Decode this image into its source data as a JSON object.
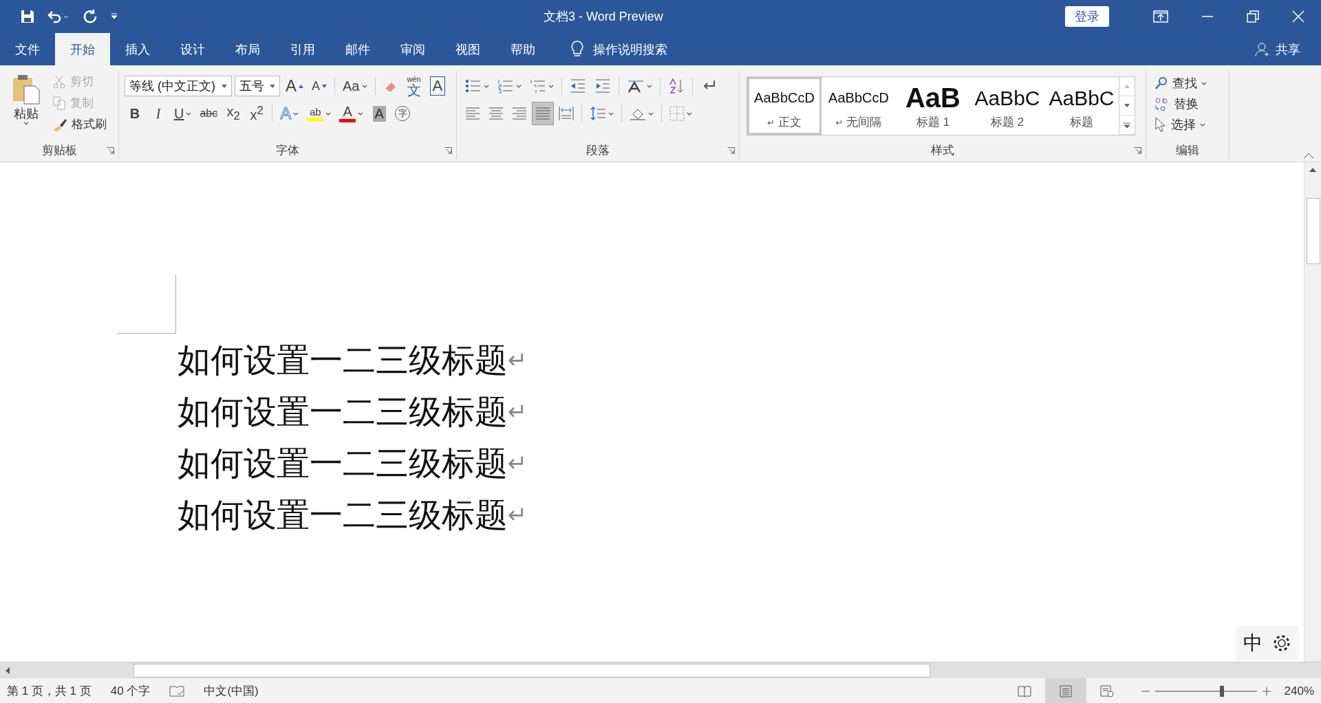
{
  "window": {
    "title": "文档3  -  Word Preview",
    "sign_in": "登录"
  },
  "tabs": [
    {
      "label": "文件",
      "selected": false
    },
    {
      "label": "开始",
      "selected": true
    },
    {
      "label": "插入",
      "selected": false
    },
    {
      "label": "设计",
      "selected": false
    },
    {
      "label": "布局",
      "selected": false
    },
    {
      "label": "引用",
      "selected": false
    },
    {
      "label": "邮件",
      "selected": false
    },
    {
      "label": "审阅",
      "selected": false
    },
    {
      "label": "视图",
      "selected": false
    },
    {
      "label": "帮助",
      "selected": false
    }
  ],
  "tell_me": "操作说明搜索",
  "share": "共享",
  "clipboard": {
    "paste": "粘贴",
    "items": [
      {
        "kind": "cut",
        "label": "剪切",
        "disabled": true
      },
      {
        "kind": "copy",
        "label": "复制",
        "disabled": true
      },
      {
        "kind": "painter",
        "label": "格式刷",
        "disabled": false
      }
    ],
    "label": "剪贴板"
  },
  "font": {
    "font_name": "等线 (中文正文)",
    "font_size": "五号",
    "label": "字体",
    "row1": [
      {
        "kind": "grow",
        "text": "A"
      },
      {
        "kind": "shrink",
        "text": "A"
      },
      {
        "kind": "case",
        "text": "Aa",
        "dropdown": true
      },
      {
        "kind": "eraser"
      },
      {
        "kind": "phonetic",
        "text": "wén",
        "text2": "文"
      },
      {
        "kind": "border",
        "text": "A"
      }
    ],
    "row2": [
      {
        "kind": "bold",
        "text": "B"
      },
      {
        "kind": "italic",
        "text": "I"
      },
      {
        "kind": "underline",
        "text": "U",
        "dropdown": true
      },
      {
        "kind": "strike",
        "text": "abc"
      },
      {
        "kind": "sub",
        "text": "x$_{2}$"
      },
      {
        "kind": "sup",
        "text": "x$^{2}$"
      },
      {
        "kind": "effect",
        "text": "A",
        "dropdown": true
      },
      {
        "kind": "highlight",
        "text": "ab",
        "color": "#ffff00",
        "dropdown": true
      },
      {
        "kind": "color",
        "text": "A",
        "color": "#ff0000",
        "dropdown": true
      },
      {
        "kind": "shading",
        "text": "A"
      },
      {
        "kind": "enclose",
        "text": "字"
      }
    ]
  },
  "paragraph": {
    "label": "段落",
    "row1": [
      {
        "kind": "bullets",
        "dropdown": true
      },
      {
        "kind": "numbering",
        "dropdown": true
      },
      {
        "kind": "multilevel",
        "dropdown": true
      },
      {
        "kind": "outdent"
      },
      {
        "kind": "indent"
      },
      {
        "kind": "direction",
        "dropdown": true
      },
      {
        "kind": "sort"
      },
      {
        "kind": "marks"
      }
    ],
    "alignment": [
      {
        "kind": "left",
        "selected": false
      },
      {
        "kind": "center",
        "selected": false
      },
      {
        "kind": "right",
        "selected": false
      },
      {
        "kind": "justify",
        "selected": true
      },
      {
        "kind": "distributed",
        "selected": false
      }
    ],
    "row2": [
      {
        "kind": "spacing",
        "dropdown": true
      },
      {
        "kind": "shading",
        "dropdown": true
      },
      {
        "kind": "borders",
        "dropdown": true
      }
    ]
  },
  "styles": {
    "label": "样式",
    "items": [
      {
        "kind": "normal",
        "preview": "AaBbCcD",
        "name": "正文",
        "mark": "↵",
        "selected": true
      },
      {
        "kind": "normal",
        "preview": "AaBbCcD",
        "name": "无间隔",
        "mark": "↵",
        "selected": false
      },
      {
        "kind": "h1",
        "preview": "AaB",
        "name": "标题 1",
        "selected": false
      },
      {
        "kind": "h2",
        "preview": "AaBbC",
        "name": "标题 2",
        "selected": false
      },
      {
        "kind": "title",
        "preview": "AaBbC",
        "name": "标题",
        "selected": false
      }
    ]
  },
  "editing": {
    "label": "编辑",
    "items": [
      {
        "kind": "find",
        "label": "查找",
        "dropdown": true
      },
      {
        "kind": "replace",
        "label": "替换",
        "dropdown": false
      },
      {
        "kind": "select",
        "label": "选择",
        "dropdown": true
      }
    ]
  },
  "document": {
    "paragraphs": [
      {
        "text": "如何设置一二三级标题",
        "mark": "↵"
      },
      {
        "text": "如何设置一二三级标题",
        "mark": "↵"
      },
      {
        "text": "如何设置一二三级标题",
        "mark": "↵"
      },
      {
        "text": "如何设置一二三级标题",
        "mark": "↵"
      }
    ]
  },
  "ime": {
    "mode": "中"
  },
  "status_bar": {
    "page": "第 1 页，共 1 页",
    "words": "40 个字",
    "language": "中文(中国)",
    "views": [
      {
        "kind": "read",
        "selected": false
      },
      {
        "kind": "print",
        "selected": true
      },
      {
        "kind": "web",
        "selected": false
      }
    ],
    "zoom": {
      "level": 0.66,
      "reading": "240%"
    }
  }
}
